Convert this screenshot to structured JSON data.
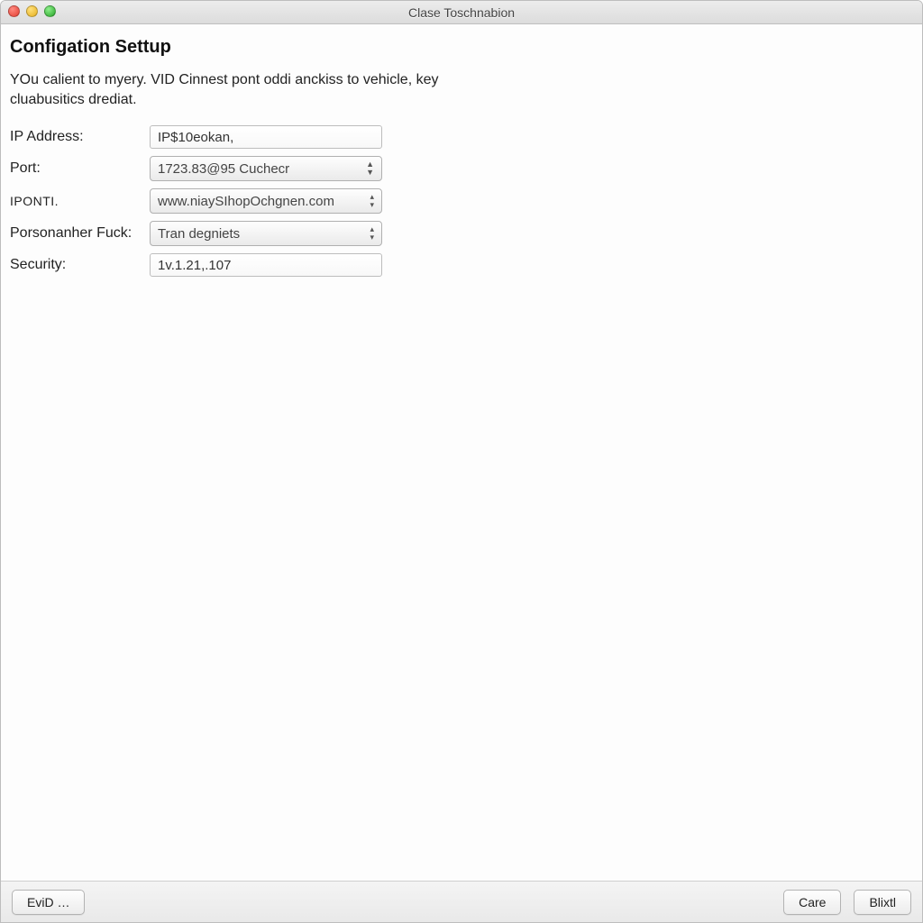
{
  "window": {
    "title": "Clase Toschnabion"
  },
  "header": {
    "heading": "Configation Settup"
  },
  "description": "YOu calient to myery. VID Cinnest pont oddi anckiss to vehicle, key cluabusitics drediat.",
  "form": {
    "ip_address": {
      "label": "IP Address:",
      "value": "IP$10eokan,"
    },
    "port": {
      "label": "Port:",
      "value": "1723.83@95 Cuchecr"
    },
    "iponti": {
      "label": "IPONTI.",
      "value": "www.niaySIhopOchgnen.com"
    },
    "porsonanher": {
      "label": "Porsonanher Fuck:",
      "value": "Tran degniets"
    },
    "security": {
      "label": "Security:",
      "value": "1v.1.21,.107"
    }
  },
  "footer": {
    "evid": "EviD …",
    "care": "Care",
    "blixtl": "Blixtl"
  }
}
